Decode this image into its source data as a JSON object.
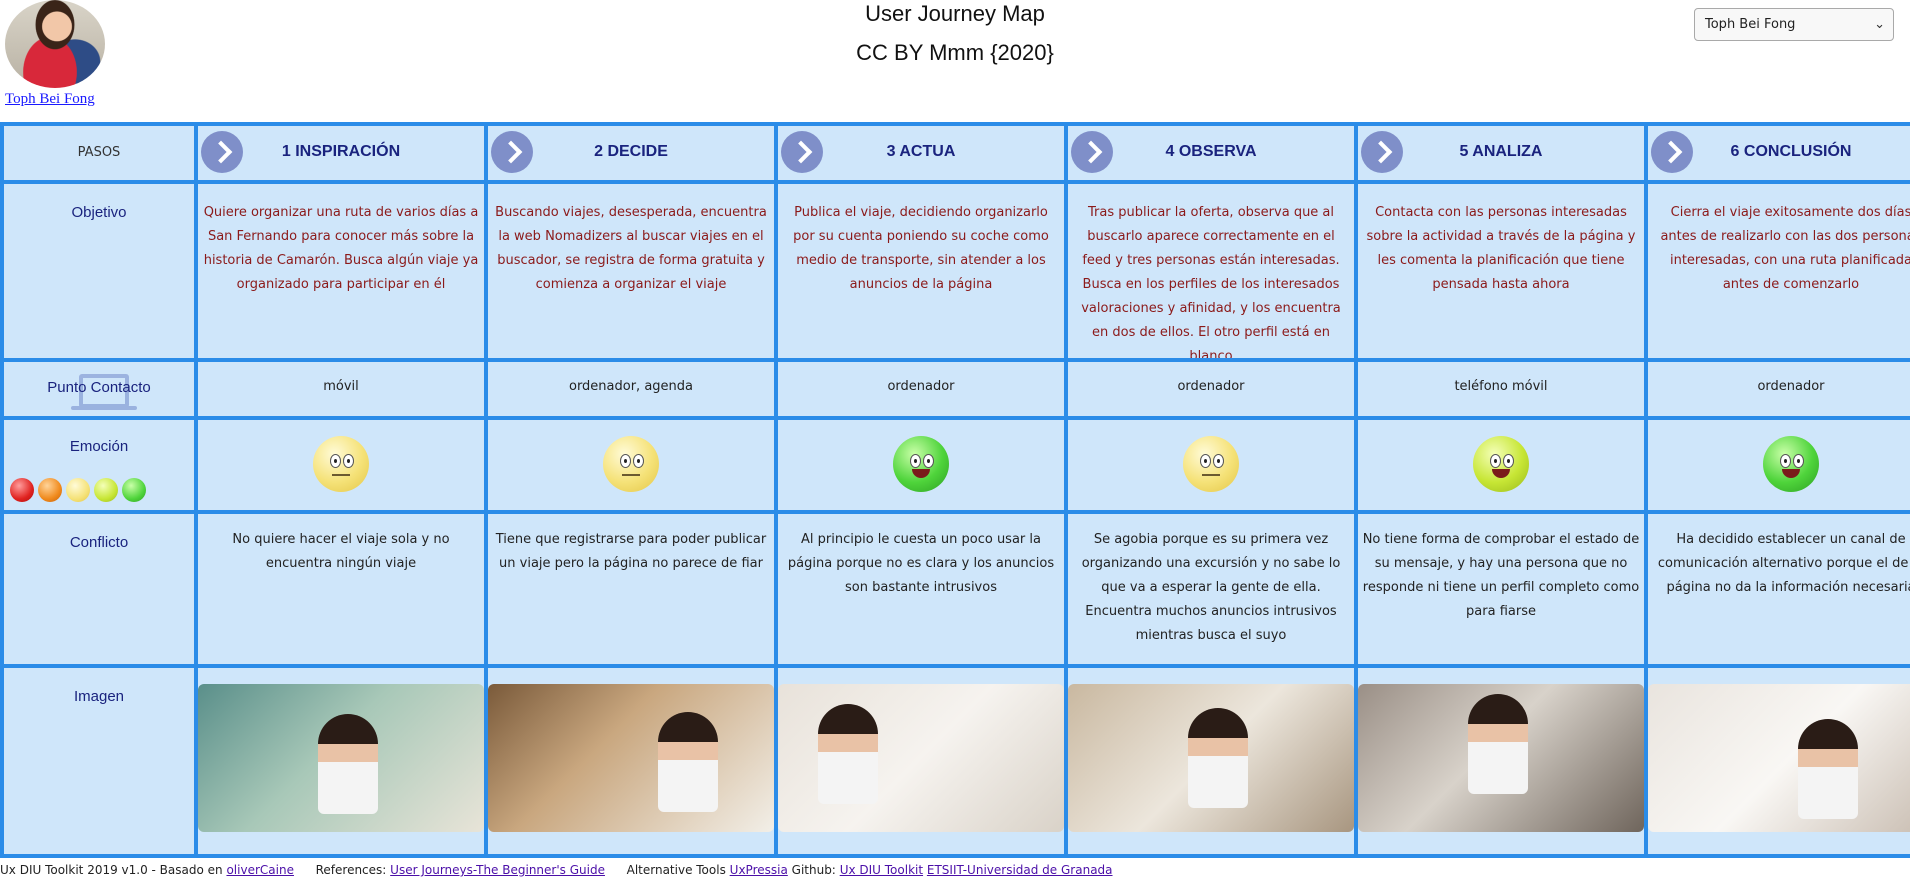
{
  "header": {
    "title": "User Journey Map",
    "subtitle": "CC BY Mmm {2020}",
    "persona_name": "Toph Bei Fong",
    "persona_select_value": "Toph Bei Fong"
  },
  "row_labels": {
    "steps": "PASOS",
    "objective": "Objetivo",
    "touchpoint": "Punto Contacto",
    "emotion": "Emoción",
    "conflict": "Conflicto",
    "image": "Imagen"
  },
  "steps": [
    {
      "title": "1 INSPIRACIÓN",
      "objective": "Quiere organizar una ruta de varios días a San Fernando para conocer más sobre la historia de Camarón. Busca algún viaje ya organizado para participar en él",
      "touchpoint": "móvil",
      "emotion": "neutral",
      "conflict": "No quiere hacer el viaje sola y no encuentra ningún viaje"
    },
    {
      "title": "2 DECIDE",
      "objective": "Buscando viajes, desesperada, encuentra la web Nomadizers al buscar viajes en el buscador, se registra de forma gratuita y comienza a organizar el viaje",
      "touchpoint": "ordenador, agenda",
      "emotion": "neutral",
      "conflict": "Tiene que registrarse para poder publicar un viaje pero la página no parece de fiar"
    },
    {
      "title": "3 ACTUA",
      "objective": "Publica el viaje, decidiendo organizarlo por su cuenta poniendo su coche como medio de transporte, sin atender a los anuncios de la página",
      "touchpoint": "ordenador",
      "emotion": "happy",
      "conflict": "Al principio le cuesta un poco usar la página porque no es clara y los anuncios son bastante intrusivos"
    },
    {
      "title": "4 OBSERVA",
      "objective": "Tras publicar la oferta, observa que al buscarlo aparece correctamente en el feed y tres personas están interesadas. Busca en los perfiles de los interesados valoraciones y afinidad, y los encuentra en dos de ellos. El otro perfil está en blanco",
      "touchpoint": "ordenador",
      "emotion": "neutral",
      "conflict": "Se agobia porque es su primera vez organizando una excursión y no sabe lo que va a esperar la gente de ella. Encuentra muchos anuncios intrusivos mientras busca el suyo"
    },
    {
      "title": "5 ANALIZA",
      "objective": "Contacta con las personas interesadas sobre la actividad a través de la página y les comenta la planificación que tiene pensada hasta ahora",
      "touchpoint": "teléfono móvil",
      "emotion": "good",
      "conflict": "No tiene forma de comprobar el estado de su mensaje, y hay una persona que no responde ni tiene un perfil completo como para fiarse"
    },
    {
      "title": "6 CONCLUSIÓN",
      "objective": "Cierra el viaje exitosamente dos días antes de realizarlo con las dos personas interesadas, con una ruta planificada antes de comenzarlo",
      "touchpoint": "ordenador",
      "emotion": "happy",
      "conflict": "Ha decidido establecer un canal de comunicación alternativo porque el de la página no da la información necesaria"
    }
  ],
  "colors": {
    "grid_border": "#2b8ce8",
    "cell_bg": "#cfe6fa",
    "label_text": "#1a237e",
    "objective_text": "#8b1a1a"
  },
  "footer": {
    "credit": "Ux DIU Toolkit 2019 v1.0 - Basado en",
    "credit_link": "oliverCaine",
    "references_label": "References:",
    "references_link": "User Journeys-The Beginner's Guide",
    "alt_tools_label": "Alternative Tools",
    "alt_tools_link": "UxPressia",
    "github_label": "Github:",
    "github_link": "Ux DIU Toolkit",
    "university_link": "ETSIIT-Universidad de Granada"
  }
}
